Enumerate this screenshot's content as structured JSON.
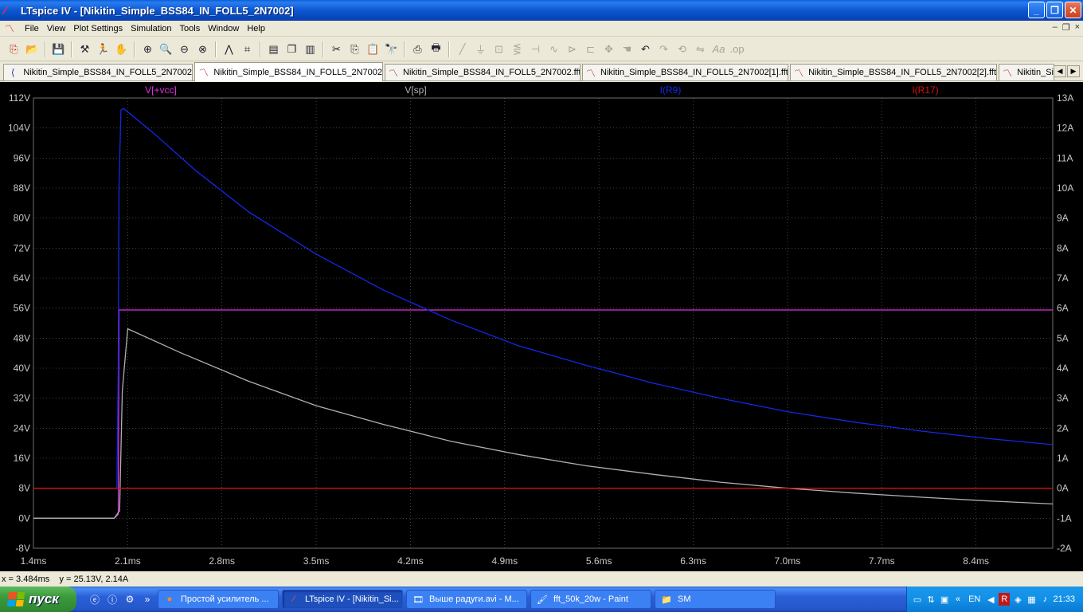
{
  "window": {
    "title": "LTspice IV - [Nikitin_Simple_BSS84_IN_FOLL5_2N7002]",
    "min": "_",
    "max": "❐",
    "close": "✕"
  },
  "menu": [
    "File",
    "View",
    "Plot Settings",
    "Simulation",
    "Tools",
    "Window",
    "Help"
  ],
  "mdi_controls": [
    "–",
    "❐",
    "×"
  ],
  "tabs": [
    {
      "label": "Nikitin_Simple_BSS84_IN_FOLL5_2N7002",
      "icon": "schematic-icon"
    },
    {
      "label": "Nikitin_Simple_BSS84_IN_FOLL5_2N7002",
      "icon": "waveform-icon",
      "active": true
    },
    {
      "label": "Nikitin_Simple_BSS84_IN_FOLL5_2N7002.fft",
      "icon": "waveform-icon"
    },
    {
      "label": "Nikitin_Simple_BSS84_IN_FOLL5_2N7002[1].fft",
      "icon": "waveform-icon"
    },
    {
      "label": "Nikitin_Simple_BSS84_IN_FOLL5_2N7002[2].fft",
      "icon": "waveform-icon"
    },
    {
      "label": "Nikitin_Si",
      "icon": "waveform-icon"
    }
  ],
  "status": {
    "readout": "x = 3.484ms    y = 25.13V, 2.14A"
  },
  "taskbar": {
    "start_label": "пуск",
    "tasks": [
      {
        "label": "Простой усилитель ...",
        "icon": "firefox-icon"
      },
      {
        "label": "LTspice IV - [Nikitin_Si...",
        "icon": "ltspice-icon",
        "active": true
      },
      {
        "label": "Выше радуги.avi - M...",
        "icon": "film-icon"
      },
      {
        "label": "fft_50k_20w - Paint",
        "icon": "paint-icon"
      },
      {
        "label": "SM",
        "icon": "folder-icon"
      }
    ],
    "lang": "EN",
    "clock": "21:33"
  },
  "chart_data": {
    "type": "line",
    "xlabel": "",
    "ylabel": "",
    "x_ticks": [
      "1.4ms",
      "2.1ms",
      "2.8ms",
      "3.5ms",
      "4.2ms",
      "4.9ms",
      "5.6ms",
      "6.3ms",
      "7.0ms",
      "7.7ms",
      "8.4ms"
    ],
    "y_left_ticks": [
      "112V",
      "104V",
      "96V",
      "88V",
      "80V",
      "72V",
      "64V",
      "56V",
      "48V",
      "40V",
      "32V",
      "24V",
      "16V",
      "8V",
      "0V",
      "-8V"
    ],
    "y_right_ticks": [
      "13A",
      "12A",
      "11A",
      "10A",
      "9A",
      "8A",
      "7A",
      "6A",
      "5A",
      "4A",
      "3A",
      "2A",
      "1A",
      "0A",
      "-1A",
      "-2A"
    ],
    "xlim": [
      1.4,
      8.97
    ],
    "ylim_left": [
      -8,
      112
    ],
    "ylim_right": [
      -2,
      13
    ],
    "grid": true,
    "background": "#000000",
    "grid_color": "#707070",
    "axis_text_color": "#c8c8c8",
    "series": [
      {
        "name": "V[+vcc]",
        "color": "#e030e0",
        "axis": "left",
        "x": [
          1.4,
          2.0,
          2.03,
          2.035,
          2.05,
          8.97
        ],
        "y": [
          0,
          0,
          1,
          55.5,
          55.5,
          55.5
        ]
      },
      {
        "name": "V[sp]",
        "color": "#b0b0b0",
        "axis": "left",
        "x": [
          1.4,
          2.0,
          2.04,
          2.06,
          2.1,
          2.5,
          3.0,
          3.5,
          4.0,
          4.5,
          5.0,
          5.5,
          6.0,
          6.5,
          7.0,
          7.5,
          8.0,
          8.5,
          8.97
        ],
        "y": [
          0,
          0,
          2,
          34,
          50.5,
          44.0,
          36.5,
          30.0,
          25.0,
          20.5,
          17.0,
          14.0,
          11.7,
          9.6,
          8.0,
          6.7,
          5.6,
          4.6,
          3.8
        ]
      },
      {
        "name": "I(R9)",
        "color": "#1428e8",
        "axis": "right",
        "x": [
          1.4,
          2.02,
          2.03,
          2.035,
          2.05,
          2.07,
          2.3,
          2.6,
          3.0,
          3.5,
          4.0,
          4.5,
          5.0,
          5.5,
          6.0,
          6.5,
          7.0,
          7.5,
          8.0,
          8.5,
          8.97
        ],
        "y": [
          0,
          0,
          4,
          10,
          12.6,
          12.65,
          11.8,
          10.6,
          9.2,
          7.8,
          6.6,
          5.6,
          4.75,
          4.1,
          3.5,
          3.0,
          2.55,
          2.2,
          1.9,
          1.65,
          1.45
        ]
      },
      {
        "name": "I(R17)",
        "color": "#d81010",
        "axis": "right",
        "x": [
          1.4,
          8.97
        ],
        "y": [
          0,
          0
        ]
      }
    ]
  }
}
